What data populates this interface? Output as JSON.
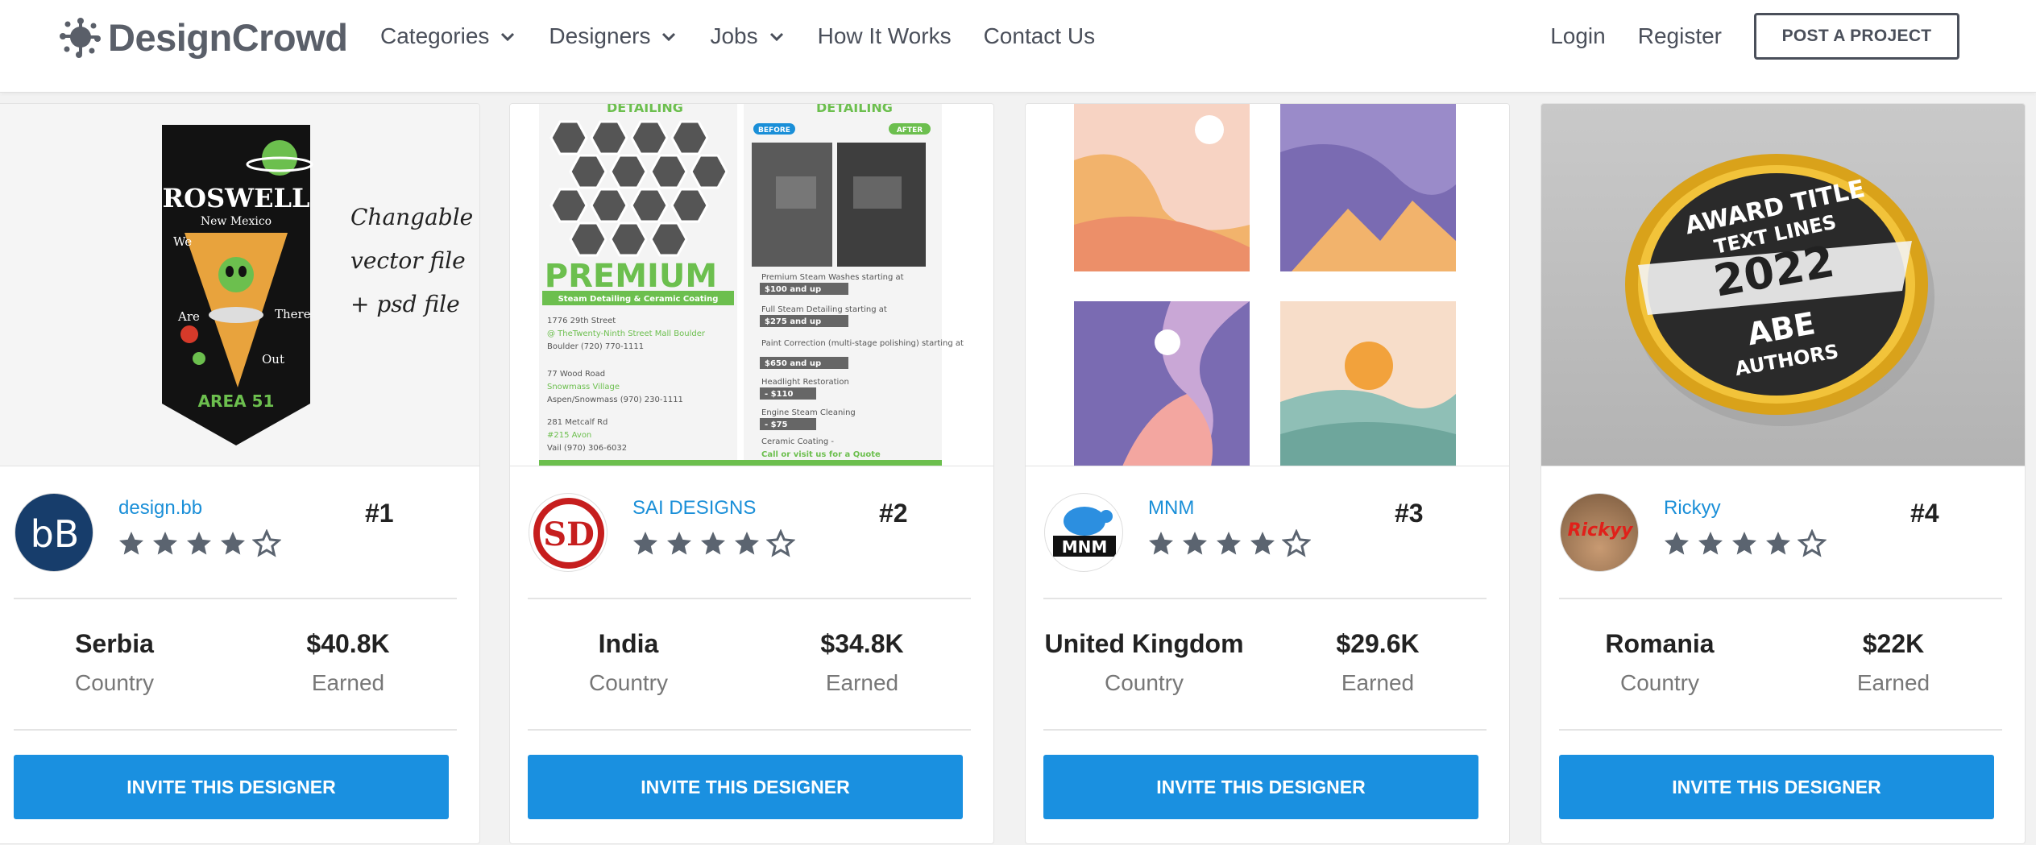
{
  "brand": {
    "name": "DesignCrowd"
  },
  "nav": {
    "items": [
      {
        "label": "Categories",
        "dropdown": true
      },
      {
        "label": "Designers",
        "dropdown": true
      },
      {
        "label": "Jobs",
        "dropdown": true
      },
      {
        "label": "How It Works",
        "dropdown": false
      },
      {
        "label": "Contact Us",
        "dropdown": false
      }
    ],
    "login": "Login",
    "register": "Register",
    "post_project": "POST A PROJECT"
  },
  "designers": [
    {
      "name": "design.bb",
      "rank": "#1",
      "rating": 4,
      "country": "Serbia",
      "country_label": "Country",
      "earned": "$40.8K",
      "earned_label": "Earned",
      "cta": "INVITE THIS DESIGNER",
      "avatar_text": "bB"
    },
    {
      "name": "SAI DESIGNS",
      "rank": "#2",
      "rating": 4,
      "country": "India",
      "country_label": "Country",
      "earned": "$34.8K",
      "earned_label": "Earned",
      "cta": "INVITE THIS DESIGNER",
      "avatar_text": "SD"
    },
    {
      "name": "MNM",
      "rank": "#3",
      "rating": 4,
      "country": "United Kingdom",
      "country_label": "Country",
      "earned": "$29.6K",
      "earned_label": "Earned",
      "cta": "INVITE THIS DESIGNER",
      "avatar_text": "MNM"
    },
    {
      "name": "Rickyy",
      "rank": "#4",
      "rating": 4,
      "country": "Romania",
      "country_label": "Country",
      "earned": "$22K",
      "earned_label": "Earned",
      "cta": "INVITE THIS DESIGNER",
      "avatar_text": "Rickyy"
    }
  ],
  "portfolio": {
    "card1": {
      "title": "ROSWELL",
      "subtitle": "New Mexico",
      "words": [
        "We",
        "Are",
        "There",
        "Out"
      ],
      "area": "AREA 51",
      "note": [
        "Changable",
        "vector file",
        "+ psd file"
      ]
    },
    "card2": {
      "brand": "DETAILING",
      "before": "BEFORE",
      "after": "AFTER",
      "premium": "PREMIUM",
      "tagline": "Steam Detailing & Ceramic Coating",
      "addresses": [
        "1776 29th Street",
        "@ TheTwenty-Ninth Street Mall Boulder",
        "Boulder (720) 770-1111",
        "77 Wood Road",
        "Snowmass Village",
        "Aspen/Snowmass (970) 230-1111",
        "281 Metcalf Rd",
        "#215 Avon",
        "Vail (970) 306-6032"
      ],
      "prices": [
        [
          "Premium Steam Washes starting at",
          "$100 and up"
        ],
        [
          "Full Steam Detailing starting at",
          "$275 and up"
        ],
        [
          "Paint Correction (multi-stage polishing) starting at",
          "$650 and up"
        ],
        [
          "Headlight Restoration",
          "- $110"
        ],
        [
          "Engine Steam Cleaning",
          "- $75"
        ],
        [
          "Ceramic Coating -",
          "Call or visit us for a Quote"
        ]
      ]
    },
    "card4": {
      "lines": [
        "AWARD TITLE",
        "TEXT LINES",
        "2022",
        "ABE",
        "AUTHORS"
      ]
    }
  },
  "colors": {
    "accent": "#1a90e0",
    "link": "#1a8fd8",
    "star": "#5b6470"
  }
}
